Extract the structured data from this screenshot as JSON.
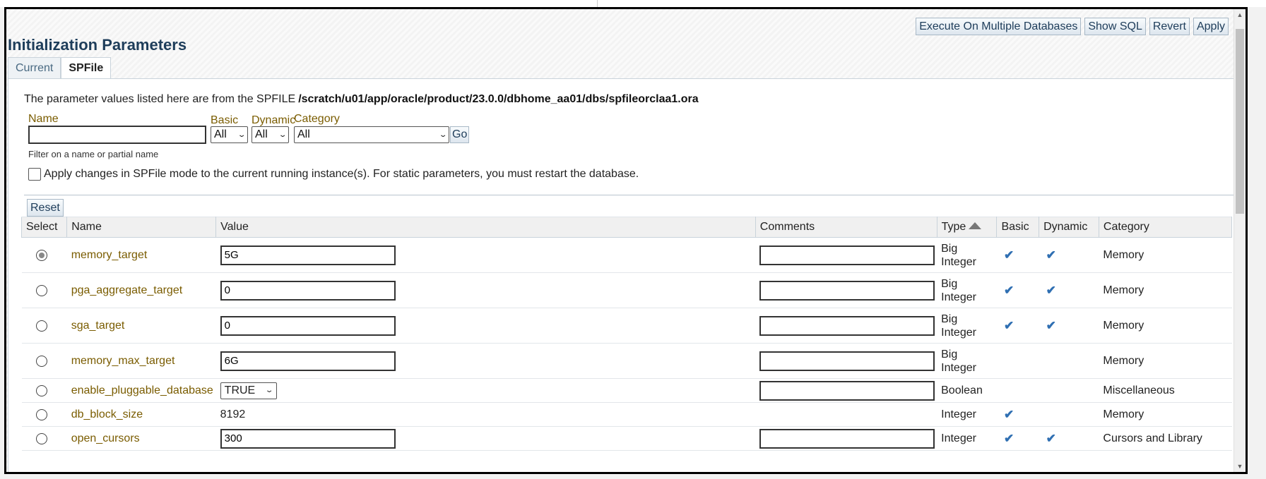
{
  "page": {
    "title": "Initialization Parameters",
    "tabs": [
      {
        "label": "Current",
        "active": false
      },
      {
        "label": "SPFile",
        "active": true
      }
    ]
  },
  "toolbar": {
    "execute_label": "Execute On Multiple Databases",
    "show_sql_label": "Show SQL",
    "revert_label": "Revert",
    "apply_label": "Apply"
  },
  "info": {
    "prefix": "The parameter values listed here are from the SPFILE",
    "path": "/scratch/u01/app/oracle/product/23.0.0/dbhome_aa01/dbs/spfileorclaa1.ora"
  },
  "filters": {
    "name_label": "Name",
    "name_value": "",
    "basic_label": "Basic",
    "basic_value": "All",
    "dynamic_label": "Dynamic",
    "dynamic_value": "All",
    "category_label": "Category",
    "category_value": "All",
    "go_label": "Go",
    "hint": "Filter on a name or partial name"
  },
  "apply_instance": {
    "checked": false,
    "label": "Apply changes in SPFile mode to the current running instance(s). For static parameters, you must restart the database."
  },
  "reset_label": "Reset",
  "table": {
    "columns": [
      "Select",
      "Name",
      "Value",
      "Comments",
      "Type",
      "Basic",
      "Dynamic",
      "Category"
    ],
    "sort_column": "Type",
    "rows": [
      {
        "selected": true,
        "name": "memory_target",
        "value": "5G",
        "value_kind": "input",
        "type_line1": "Big",
        "type_line2": "Integer",
        "basic": true,
        "dynamic": true,
        "category": "Memory"
      },
      {
        "selected": false,
        "name": "pga_aggregate_target",
        "value": "0",
        "value_kind": "input",
        "type_line1": "Big",
        "type_line2": "Integer",
        "basic": true,
        "dynamic": true,
        "category": "Memory"
      },
      {
        "selected": false,
        "name": "sga_target",
        "value": "0",
        "value_kind": "input",
        "type_line1": "Big",
        "type_line2": "Integer",
        "basic": true,
        "dynamic": true,
        "category": "Memory"
      },
      {
        "selected": false,
        "name": "memory_max_target",
        "value": "6G",
        "value_kind": "input",
        "type_line1": "Big",
        "type_line2": "Integer",
        "basic": false,
        "dynamic": false,
        "category": "Memory"
      },
      {
        "selected": false,
        "name": "enable_pluggable_database",
        "value": "TRUE",
        "value_kind": "select",
        "type_line1": "Boolean",
        "type_line2": "",
        "basic": false,
        "dynamic": false,
        "category": "Miscellaneous"
      },
      {
        "selected": false,
        "name": "db_block_size",
        "value": "8192",
        "value_kind": "text",
        "type_line1": "Integer",
        "type_line2": "",
        "basic": true,
        "dynamic": false,
        "category": "Memory"
      },
      {
        "selected": false,
        "name": "open_cursors",
        "value": "300",
        "value_kind": "input",
        "type_line1": "Integer",
        "type_line2": "",
        "basic": true,
        "dynamic": true,
        "category": "Cursors and Library"
      }
    ]
  },
  "icons": {
    "check": "check-icon",
    "sort": "sort-ascending-icon",
    "chevron": "chevron-down-icon"
  }
}
